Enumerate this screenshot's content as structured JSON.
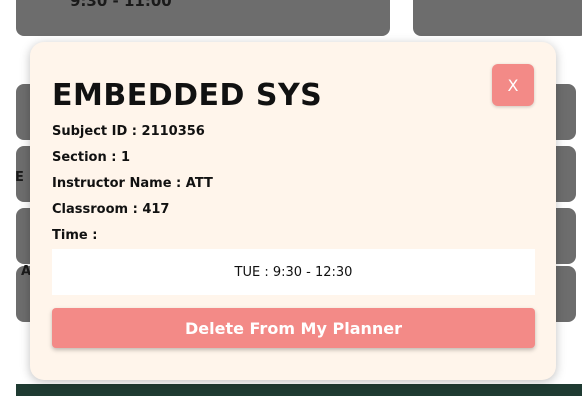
{
  "background": {
    "time_text": "9:30 - 11:00",
    "side_letter_1": "E",
    "side_letter_2": "A"
  },
  "modal": {
    "title": "EMBEDDED SYS",
    "close_label": "X",
    "subject_id": "Subject ID : 2110356",
    "section": "Section : 1",
    "instructor": "Instructor Name : ATT",
    "classroom": "Classroom : 417",
    "time_label": "Time :",
    "time_slots": [
      "TUE : 9:30 - 12:30"
    ],
    "delete_label": "Delete From My Planner"
  },
  "colors": {
    "accent": "#f38a87",
    "modal_bg": "#fff5eb",
    "overlay": "#6d6d6d",
    "footer": "#1f3b32"
  }
}
